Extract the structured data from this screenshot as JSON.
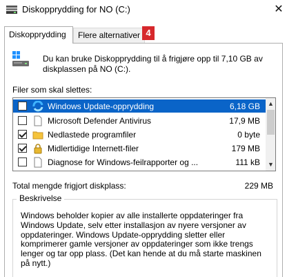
{
  "window": {
    "title": "Diskopprydding for NO (C:)",
    "close_glyph": "✕"
  },
  "tabs": [
    {
      "label": "Diskopprydding"
    },
    {
      "label": "Flere alternativer"
    }
  ],
  "badge": "4",
  "intro": "Du kan bruke Diskopprydding til å frigjøre opp til 7,10 GB av diskplassen på NO (C:).",
  "files_label": "Filer som skal slettes:",
  "files": [
    {
      "name": "Windows Update-opprydding",
      "size": "6,18 GB",
      "checked": false,
      "selected": true,
      "icon": "windows-update-icon"
    },
    {
      "name": "Microsoft Defender Antivirus",
      "size": "17,9 MB",
      "checked": false,
      "selected": false,
      "icon": "file-icon"
    },
    {
      "name": "Nedlastede programfiler",
      "size": "0 byte",
      "checked": true,
      "selected": false,
      "icon": "folder-icon"
    },
    {
      "name": "Midlertidige Internett-filer",
      "size": "179 MB",
      "checked": true,
      "selected": false,
      "icon": "lock-icon"
    },
    {
      "name": "Diagnose for Windows-feilrapporter og ...",
      "size": "111 kB",
      "checked": false,
      "selected": false,
      "icon": "file-icon"
    }
  ],
  "scroll": {
    "up": "▲",
    "down": "▼"
  },
  "total": {
    "label": "Total mengde frigjort diskplass:",
    "value": "229 MB"
  },
  "description": {
    "title": "Beskrivelse",
    "text": "Windows beholder kopier av alle installerte oppdateringer fra Windows Update, selv etter installasjon av nyere versjoner av oppdateringer. Windows Update-opprydding sletter eller komprimerer gamle versjoner av oppdateringer som ikke trengs lenger og tar opp plass. (Det kan hende at du må starte maskinen på nytt.)"
  },
  "colors": {
    "selection": "#0a64c8",
    "badge": "#d6282c"
  }
}
